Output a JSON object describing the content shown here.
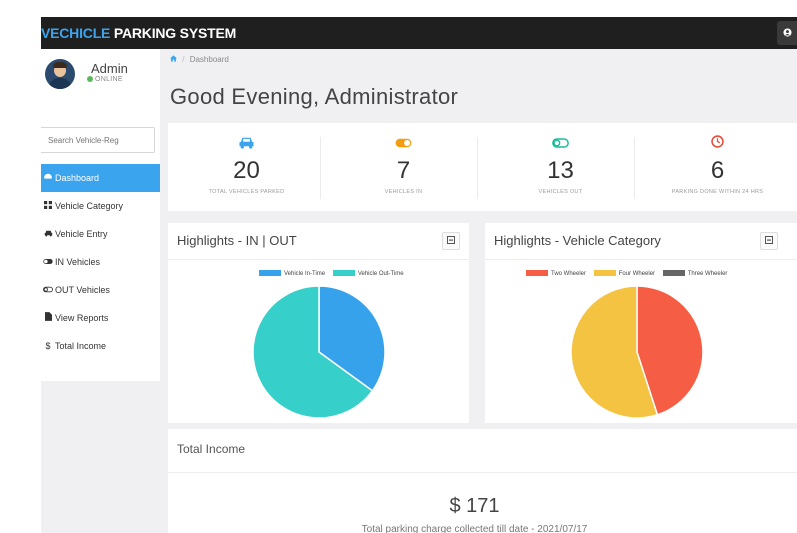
{
  "app": {
    "brand_highlight": "VECHICLE",
    "brand_rest": " PARKING SYSTEM"
  },
  "user": {
    "name": "Admin",
    "status": "ONLINE",
    "menu_icon": "user-icon"
  },
  "sidebar": {
    "search_placeholder": "Search Vehicle-Reg",
    "items": [
      {
        "label": "Dashboard",
        "icon": "dashboard-icon",
        "active": true
      },
      {
        "label": "Vehicle Category",
        "icon": "grid-icon"
      },
      {
        "label": "Vehicle Entry",
        "icon": "car-icon"
      },
      {
        "label": "IN Vehicles",
        "icon": "toggle-on-icon"
      },
      {
        "label": "OUT Vehicles",
        "icon": "toggle-off-icon"
      },
      {
        "label": "View Reports",
        "icon": "file-icon"
      },
      {
        "label": "Total Income",
        "icon": "dollar-icon"
      }
    ]
  },
  "breadcrumb": {
    "current": "Dashboard"
  },
  "greeting": "Good Evening, Administrator",
  "stats": [
    {
      "value": "20",
      "label": "TOTAL VEHICLES PARKED",
      "icon": "car-icon",
      "color": "#3ba4ee"
    },
    {
      "value": "7",
      "label": "VEHICLES IN",
      "icon": "toggle-on-icon",
      "color": "#f39c12"
    },
    {
      "value": "13",
      "label": "VEHICLES OUT",
      "icon": "toggle-off-icon",
      "color": "#1abc9c"
    },
    {
      "value": "6",
      "label": "PARKING DONE WITHIN 24 HRS",
      "icon": "clock-icon",
      "color": "#e74c3c"
    }
  ],
  "panels": {
    "in_out": {
      "title": "Highlights - IN | OUT"
    },
    "category": {
      "title": "Highlights - Vehicle Category"
    }
  },
  "chart_data": [
    {
      "type": "pie",
      "title": "Highlights - IN | OUT",
      "categories": [
        "Vehicle In-Time",
        "Vehicle Out-Time"
      ],
      "values": [
        7,
        13
      ],
      "colors": [
        "#36a2eb",
        "#36cfc9"
      ]
    },
    {
      "type": "pie",
      "title": "Highlights - Vehicle Category",
      "categories": [
        "Two Wheeler",
        "Four Wheeler",
        "Three Wheeler"
      ],
      "values": [
        9,
        11,
        0
      ],
      "colors": [
        "#f55e45",
        "#f5c342",
        "#666666"
      ]
    }
  ],
  "income": {
    "title": "Total Income",
    "amount": "$ 171",
    "note": "Total parking charge collected till date - 2021/07/17"
  }
}
